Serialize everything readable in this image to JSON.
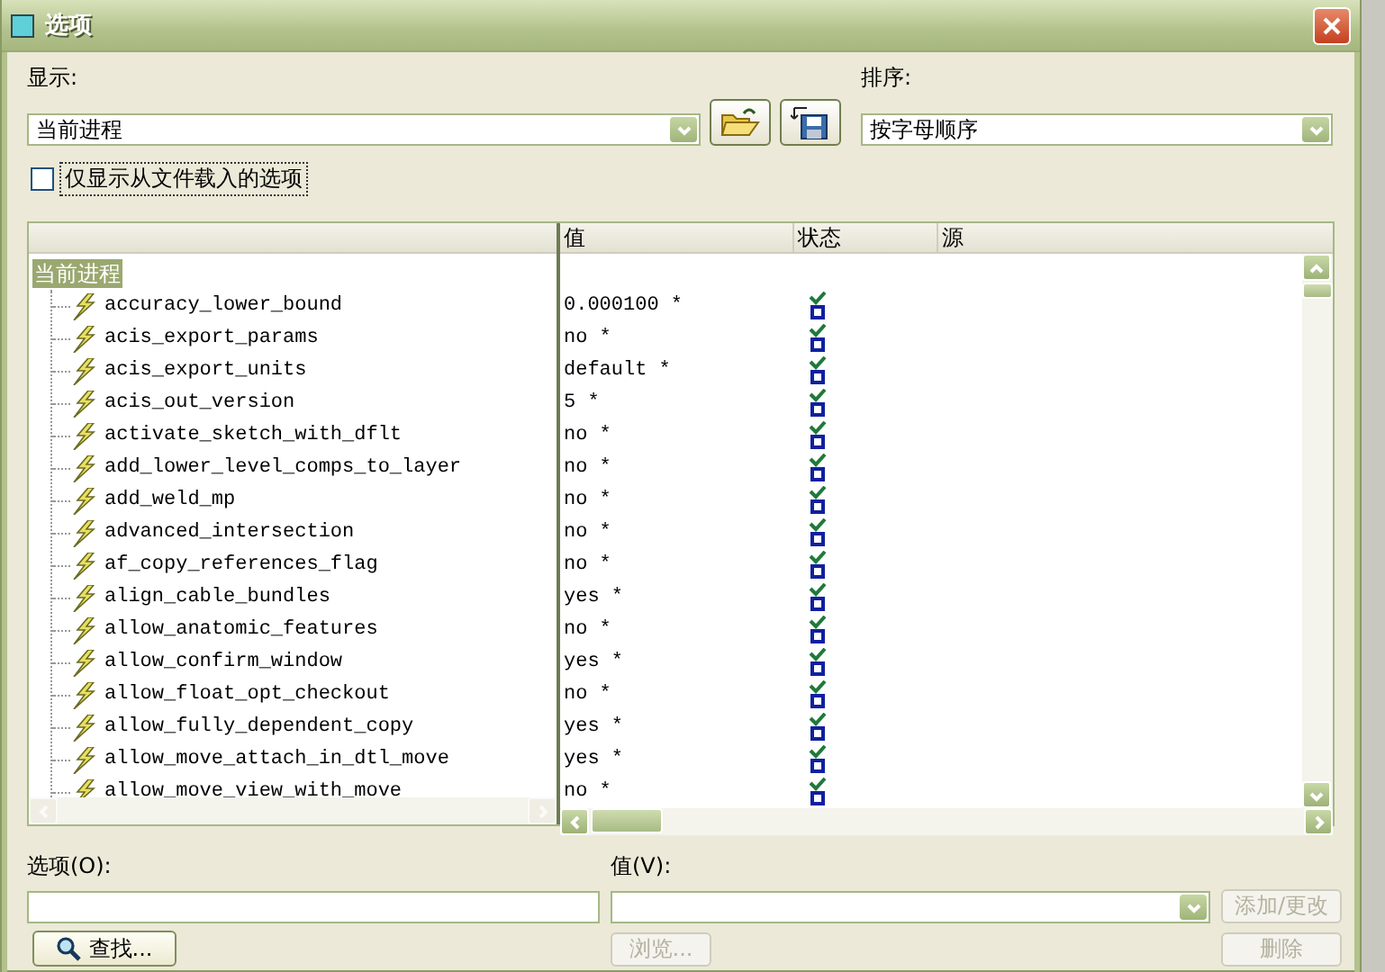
{
  "window": {
    "title": "选项"
  },
  "display": {
    "label": "显示:",
    "value": "当前进程"
  },
  "sort": {
    "label": "排序:",
    "value": "按字母顺序"
  },
  "loaded_only": {
    "label": "仅显示从文件载入的选项",
    "checked": false
  },
  "table": {
    "columns": [
      "值",
      "状态",
      "源"
    ],
    "tree": {
      "label": "当前进程",
      "selected": true,
      "children": [
        {
          "name": "accuracy_lower_bound",
          "value": "0.000100 *"
        },
        {
          "name": "acis_export_params",
          "value": "no *"
        },
        {
          "name": "acis_export_units",
          "value": "default *"
        },
        {
          "name": "acis_out_version",
          "value": "5 *"
        },
        {
          "name": "activate_sketch_with_dflt",
          "value": "no *"
        },
        {
          "name": "add_lower_level_comps_to_layer",
          "value": "no *"
        },
        {
          "name": "add_weld_mp",
          "value": "no *"
        },
        {
          "name": "advanced_intersection",
          "value": "no *"
        },
        {
          "name": "af_copy_references_flag",
          "value": "no *"
        },
        {
          "name": "align_cable_bundles",
          "value": "yes *"
        },
        {
          "name": "allow_anatomic_features",
          "value": "no *"
        },
        {
          "name": "allow_confirm_window",
          "value": "yes *"
        },
        {
          "name": "allow_float_opt_checkout",
          "value": "no *"
        },
        {
          "name": "allow_fully_dependent_copy",
          "value": "yes *"
        },
        {
          "name": "allow_move_attach_in_dtl_move",
          "value": "yes *"
        },
        {
          "name": "allow_move_view_with_move",
          "value": "no *"
        }
      ]
    }
  },
  "option_field": {
    "label": "选项(O):"
  },
  "value_field": {
    "label": "值(V):"
  },
  "buttons": [
    {
      "kind": "find",
      "label": "查找...",
      "disabled": false
    },
    {
      "kind": "browse",
      "label": "浏览...",
      "disabled": true
    },
    {
      "kind": "apply",
      "label": "添加/更改",
      "disabled": true
    },
    {
      "kind": "delete",
      "label": "删除",
      "disabled": true
    }
  ]
}
